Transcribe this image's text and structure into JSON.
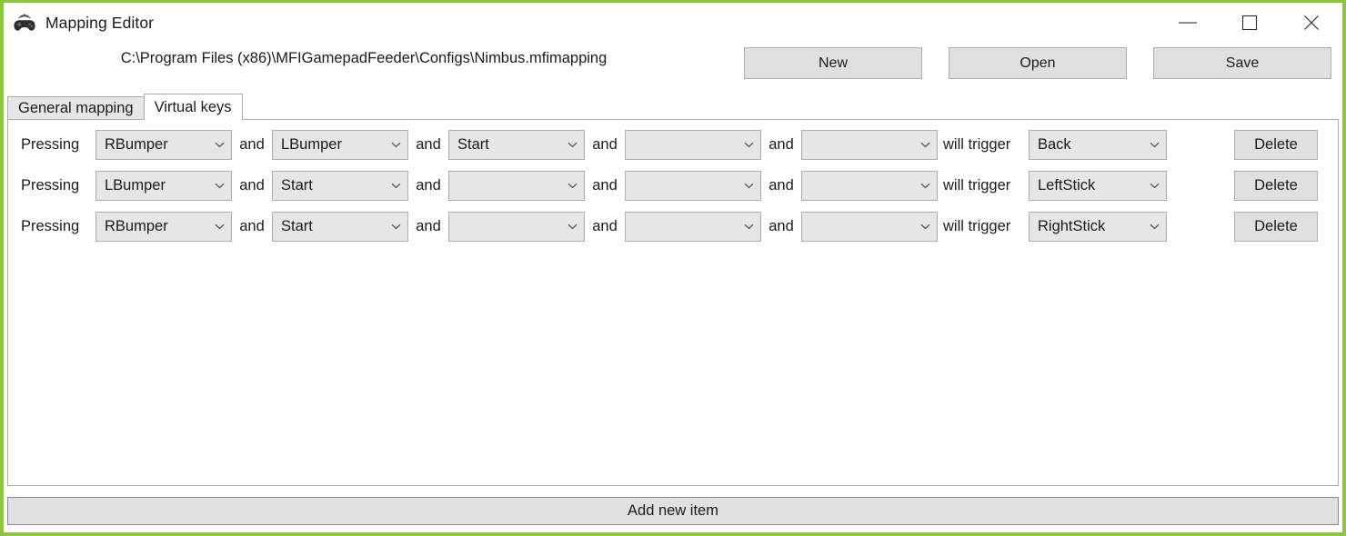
{
  "window": {
    "title": "Mapping Editor",
    "icon": "gamepad-icon",
    "accent_color": "#8CC63F",
    "controls": {
      "minimize": "minimize-icon",
      "maximize": "maximize-icon",
      "close": "close-icon"
    }
  },
  "toolbar": {
    "config_path": "C:\\Program Files (x86)\\MFIGamepadFeeder\\Configs\\Nimbus.mfimapping",
    "new_label": "New",
    "open_label": "Open",
    "save_label": "Save"
  },
  "tabs": [
    {
      "label": "General mapping",
      "active": false
    },
    {
      "label": "Virtual keys",
      "active": true
    }
  ],
  "virtual_keys": {
    "labels": {
      "pressing": "Pressing",
      "and": "and",
      "will_trigger": "will trigger",
      "delete": "Delete"
    },
    "rows": [
      {
        "conditions": [
          "RBumper",
          "LBumper",
          "Start",
          "",
          ""
        ],
        "trigger": "Back",
        "delete_label": "Delete"
      },
      {
        "conditions": [
          "LBumper",
          "Start",
          "",
          "",
          ""
        ],
        "trigger": "LeftStick",
        "delete_label": "Delete"
      },
      {
        "conditions": [
          "RBumper",
          "Start",
          "",
          "",
          ""
        ],
        "trigger": "RightStick",
        "delete_label": "Delete"
      }
    ]
  },
  "footer": {
    "add_new_item_label": "Add new item"
  }
}
